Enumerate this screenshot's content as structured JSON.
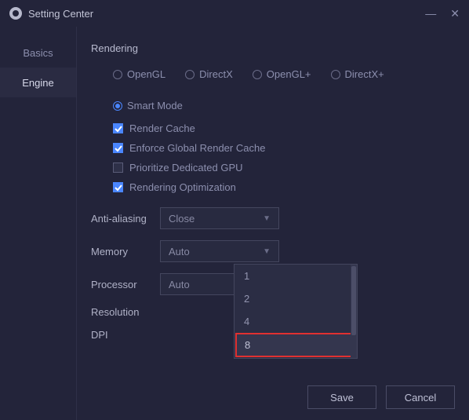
{
  "window": {
    "title": "Setting Center"
  },
  "sidebar": {
    "items": [
      {
        "label": "Basics"
      },
      {
        "label": "Engine"
      }
    ],
    "active_index": 1
  },
  "section": {
    "header": "Rendering",
    "radios": [
      {
        "label": "OpenGL"
      },
      {
        "label": "DirectX"
      },
      {
        "label": "OpenGL+"
      },
      {
        "label": "DirectX+"
      },
      {
        "label": "Smart Mode"
      }
    ],
    "radio_selected_index": 4,
    "checks": [
      {
        "label": "Render Cache",
        "checked": true
      },
      {
        "label": "Enforce Global Render Cache",
        "checked": true
      },
      {
        "label": "Prioritize Dedicated GPU",
        "checked": false
      },
      {
        "label": "Rendering Optimization",
        "checked": true
      }
    ],
    "rows": [
      {
        "label": "Anti-aliasing",
        "value": "Close"
      },
      {
        "label": "Memory",
        "value": "Auto"
      },
      {
        "label": "Processor",
        "value": "Auto"
      },
      {
        "label": "Resolution",
        "value": ""
      },
      {
        "label": "DPI",
        "value": ""
      }
    ],
    "processor_dropdown": {
      "options": [
        "1",
        "2",
        "4",
        "8"
      ],
      "highlight_index": 3
    }
  },
  "footer": {
    "save": "Save",
    "cancel": "Cancel"
  }
}
